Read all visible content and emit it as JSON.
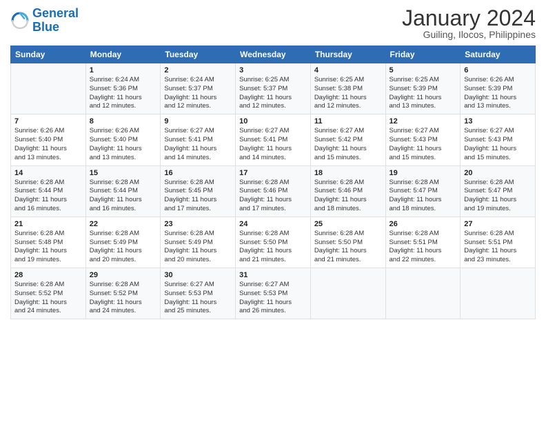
{
  "logo": {
    "line1": "General",
    "line2": "Blue"
  },
  "title": "January 2024",
  "subtitle": "Guiling, Ilocos, Philippines",
  "days_header": [
    "Sunday",
    "Monday",
    "Tuesday",
    "Wednesday",
    "Thursday",
    "Friday",
    "Saturday"
  ],
  "weeks": [
    [
      {
        "day": "",
        "info": ""
      },
      {
        "day": "1",
        "info": "Sunrise: 6:24 AM\nSunset: 5:36 PM\nDaylight: 11 hours\nand 12 minutes."
      },
      {
        "day": "2",
        "info": "Sunrise: 6:24 AM\nSunset: 5:37 PM\nDaylight: 11 hours\nand 12 minutes."
      },
      {
        "day": "3",
        "info": "Sunrise: 6:25 AM\nSunset: 5:37 PM\nDaylight: 11 hours\nand 12 minutes."
      },
      {
        "day": "4",
        "info": "Sunrise: 6:25 AM\nSunset: 5:38 PM\nDaylight: 11 hours\nand 12 minutes."
      },
      {
        "day": "5",
        "info": "Sunrise: 6:25 AM\nSunset: 5:39 PM\nDaylight: 11 hours\nand 13 minutes."
      },
      {
        "day": "6",
        "info": "Sunrise: 6:26 AM\nSunset: 5:39 PM\nDaylight: 11 hours\nand 13 minutes."
      }
    ],
    [
      {
        "day": "7",
        "info": "Sunrise: 6:26 AM\nSunset: 5:40 PM\nDaylight: 11 hours\nand 13 minutes."
      },
      {
        "day": "8",
        "info": "Sunrise: 6:26 AM\nSunset: 5:40 PM\nDaylight: 11 hours\nand 13 minutes."
      },
      {
        "day": "9",
        "info": "Sunrise: 6:27 AM\nSunset: 5:41 PM\nDaylight: 11 hours\nand 14 minutes."
      },
      {
        "day": "10",
        "info": "Sunrise: 6:27 AM\nSunset: 5:41 PM\nDaylight: 11 hours\nand 14 minutes."
      },
      {
        "day": "11",
        "info": "Sunrise: 6:27 AM\nSunset: 5:42 PM\nDaylight: 11 hours\nand 15 minutes."
      },
      {
        "day": "12",
        "info": "Sunrise: 6:27 AM\nSunset: 5:43 PM\nDaylight: 11 hours\nand 15 minutes."
      },
      {
        "day": "13",
        "info": "Sunrise: 6:27 AM\nSunset: 5:43 PM\nDaylight: 11 hours\nand 15 minutes."
      }
    ],
    [
      {
        "day": "14",
        "info": "Sunrise: 6:28 AM\nSunset: 5:44 PM\nDaylight: 11 hours\nand 16 minutes."
      },
      {
        "day": "15",
        "info": "Sunrise: 6:28 AM\nSunset: 5:44 PM\nDaylight: 11 hours\nand 16 minutes."
      },
      {
        "day": "16",
        "info": "Sunrise: 6:28 AM\nSunset: 5:45 PM\nDaylight: 11 hours\nand 17 minutes."
      },
      {
        "day": "17",
        "info": "Sunrise: 6:28 AM\nSunset: 5:46 PM\nDaylight: 11 hours\nand 17 minutes."
      },
      {
        "day": "18",
        "info": "Sunrise: 6:28 AM\nSunset: 5:46 PM\nDaylight: 11 hours\nand 18 minutes."
      },
      {
        "day": "19",
        "info": "Sunrise: 6:28 AM\nSunset: 5:47 PM\nDaylight: 11 hours\nand 18 minutes."
      },
      {
        "day": "20",
        "info": "Sunrise: 6:28 AM\nSunset: 5:47 PM\nDaylight: 11 hours\nand 19 minutes."
      }
    ],
    [
      {
        "day": "21",
        "info": "Sunrise: 6:28 AM\nSunset: 5:48 PM\nDaylight: 11 hours\nand 19 minutes."
      },
      {
        "day": "22",
        "info": "Sunrise: 6:28 AM\nSunset: 5:49 PM\nDaylight: 11 hours\nand 20 minutes."
      },
      {
        "day": "23",
        "info": "Sunrise: 6:28 AM\nSunset: 5:49 PM\nDaylight: 11 hours\nand 20 minutes."
      },
      {
        "day": "24",
        "info": "Sunrise: 6:28 AM\nSunset: 5:50 PM\nDaylight: 11 hours\nand 21 minutes."
      },
      {
        "day": "25",
        "info": "Sunrise: 6:28 AM\nSunset: 5:50 PM\nDaylight: 11 hours\nand 21 minutes."
      },
      {
        "day": "26",
        "info": "Sunrise: 6:28 AM\nSunset: 5:51 PM\nDaylight: 11 hours\nand 22 minutes."
      },
      {
        "day": "27",
        "info": "Sunrise: 6:28 AM\nSunset: 5:51 PM\nDaylight: 11 hours\nand 23 minutes."
      }
    ],
    [
      {
        "day": "28",
        "info": "Sunrise: 6:28 AM\nSunset: 5:52 PM\nDaylight: 11 hours\nand 24 minutes."
      },
      {
        "day": "29",
        "info": "Sunrise: 6:28 AM\nSunset: 5:52 PM\nDaylight: 11 hours\nand 24 minutes."
      },
      {
        "day": "30",
        "info": "Sunrise: 6:27 AM\nSunset: 5:53 PM\nDaylight: 11 hours\nand 25 minutes."
      },
      {
        "day": "31",
        "info": "Sunrise: 6:27 AM\nSunset: 5:53 PM\nDaylight: 11 hours\nand 26 minutes."
      },
      {
        "day": "",
        "info": ""
      },
      {
        "day": "",
        "info": ""
      },
      {
        "day": "",
        "info": ""
      }
    ]
  ]
}
